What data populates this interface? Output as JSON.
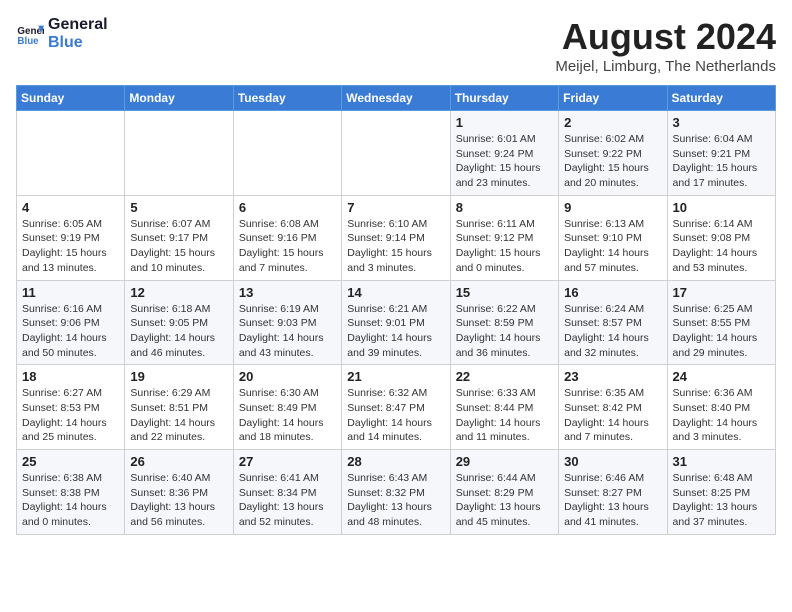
{
  "header": {
    "logo_line1": "General",
    "logo_line2": "Blue",
    "month_title": "August 2024",
    "subtitle": "Meijel, Limburg, The Netherlands"
  },
  "days_of_week": [
    "Sunday",
    "Monday",
    "Tuesday",
    "Wednesday",
    "Thursday",
    "Friday",
    "Saturday"
  ],
  "weeks": [
    [
      {
        "day": "",
        "info": ""
      },
      {
        "day": "",
        "info": ""
      },
      {
        "day": "",
        "info": ""
      },
      {
        "day": "",
        "info": ""
      },
      {
        "day": "1",
        "info": "Sunrise: 6:01 AM\nSunset: 9:24 PM\nDaylight: 15 hours\nand 23 minutes."
      },
      {
        "day": "2",
        "info": "Sunrise: 6:02 AM\nSunset: 9:22 PM\nDaylight: 15 hours\nand 20 minutes."
      },
      {
        "day": "3",
        "info": "Sunrise: 6:04 AM\nSunset: 9:21 PM\nDaylight: 15 hours\nand 17 minutes."
      }
    ],
    [
      {
        "day": "4",
        "info": "Sunrise: 6:05 AM\nSunset: 9:19 PM\nDaylight: 15 hours\nand 13 minutes."
      },
      {
        "day": "5",
        "info": "Sunrise: 6:07 AM\nSunset: 9:17 PM\nDaylight: 15 hours\nand 10 minutes."
      },
      {
        "day": "6",
        "info": "Sunrise: 6:08 AM\nSunset: 9:16 PM\nDaylight: 15 hours\nand 7 minutes."
      },
      {
        "day": "7",
        "info": "Sunrise: 6:10 AM\nSunset: 9:14 PM\nDaylight: 15 hours\nand 3 minutes."
      },
      {
        "day": "8",
        "info": "Sunrise: 6:11 AM\nSunset: 9:12 PM\nDaylight: 15 hours\nand 0 minutes."
      },
      {
        "day": "9",
        "info": "Sunrise: 6:13 AM\nSunset: 9:10 PM\nDaylight: 14 hours\nand 57 minutes."
      },
      {
        "day": "10",
        "info": "Sunrise: 6:14 AM\nSunset: 9:08 PM\nDaylight: 14 hours\nand 53 minutes."
      }
    ],
    [
      {
        "day": "11",
        "info": "Sunrise: 6:16 AM\nSunset: 9:06 PM\nDaylight: 14 hours\nand 50 minutes."
      },
      {
        "day": "12",
        "info": "Sunrise: 6:18 AM\nSunset: 9:05 PM\nDaylight: 14 hours\nand 46 minutes."
      },
      {
        "day": "13",
        "info": "Sunrise: 6:19 AM\nSunset: 9:03 PM\nDaylight: 14 hours\nand 43 minutes."
      },
      {
        "day": "14",
        "info": "Sunrise: 6:21 AM\nSunset: 9:01 PM\nDaylight: 14 hours\nand 39 minutes."
      },
      {
        "day": "15",
        "info": "Sunrise: 6:22 AM\nSunset: 8:59 PM\nDaylight: 14 hours\nand 36 minutes."
      },
      {
        "day": "16",
        "info": "Sunrise: 6:24 AM\nSunset: 8:57 PM\nDaylight: 14 hours\nand 32 minutes."
      },
      {
        "day": "17",
        "info": "Sunrise: 6:25 AM\nSunset: 8:55 PM\nDaylight: 14 hours\nand 29 minutes."
      }
    ],
    [
      {
        "day": "18",
        "info": "Sunrise: 6:27 AM\nSunset: 8:53 PM\nDaylight: 14 hours\nand 25 minutes."
      },
      {
        "day": "19",
        "info": "Sunrise: 6:29 AM\nSunset: 8:51 PM\nDaylight: 14 hours\nand 22 minutes."
      },
      {
        "day": "20",
        "info": "Sunrise: 6:30 AM\nSunset: 8:49 PM\nDaylight: 14 hours\nand 18 minutes."
      },
      {
        "day": "21",
        "info": "Sunrise: 6:32 AM\nSunset: 8:47 PM\nDaylight: 14 hours\nand 14 minutes."
      },
      {
        "day": "22",
        "info": "Sunrise: 6:33 AM\nSunset: 8:44 PM\nDaylight: 14 hours\nand 11 minutes."
      },
      {
        "day": "23",
        "info": "Sunrise: 6:35 AM\nSunset: 8:42 PM\nDaylight: 14 hours\nand 7 minutes."
      },
      {
        "day": "24",
        "info": "Sunrise: 6:36 AM\nSunset: 8:40 PM\nDaylight: 14 hours\nand 3 minutes."
      }
    ],
    [
      {
        "day": "25",
        "info": "Sunrise: 6:38 AM\nSunset: 8:38 PM\nDaylight: 14 hours\nand 0 minutes."
      },
      {
        "day": "26",
        "info": "Sunrise: 6:40 AM\nSunset: 8:36 PM\nDaylight: 13 hours\nand 56 minutes."
      },
      {
        "day": "27",
        "info": "Sunrise: 6:41 AM\nSunset: 8:34 PM\nDaylight: 13 hours\nand 52 minutes."
      },
      {
        "day": "28",
        "info": "Sunrise: 6:43 AM\nSunset: 8:32 PM\nDaylight: 13 hours\nand 48 minutes."
      },
      {
        "day": "29",
        "info": "Sunrise: 6:44 AM\nSunset: 8:29 PM\nDaylight: 13 hours\nand 45 minutes."
      },
      {
        "day": "30",
        "info": "Sunrise: 6:46 AM\nSunset: 8:27 PM\nDaylight: 13 hours\nand 41 minutes."
      },
      {
        "day": "31",
        "info": "Sunrise: 6:48 AM\nSunset: 8:25 PM\nDaylight: 13 hours\nand 37 minutes."
      }
    ]
  ]
}
